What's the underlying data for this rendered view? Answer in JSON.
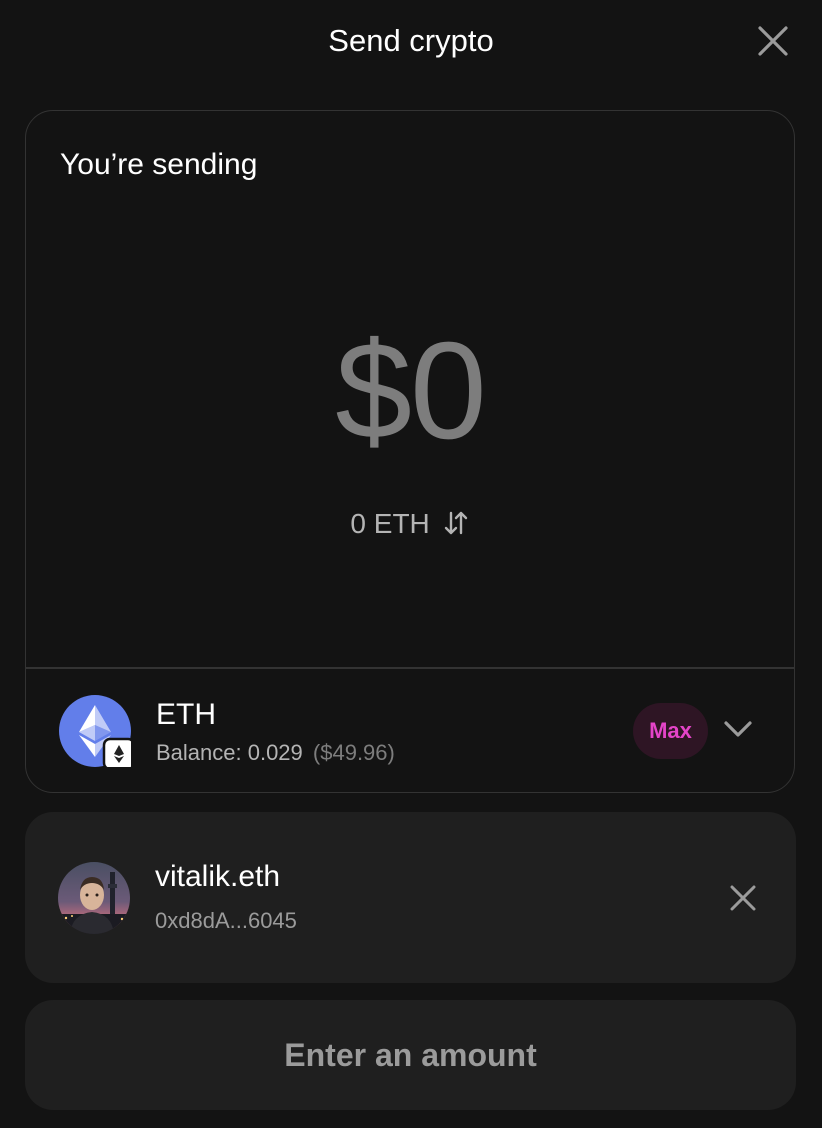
{
  "header": {
    "title": "Send crypto",
    "close_icon": "close-icon"
  },
  "send_card": {
    "label": "You’re sending",
    "amount_fiat": "$0",
    "amount_crypto": "0 ETH",
    "swap_icon": "swap-arrows-icon"
  },
  "token": {
    "symbol": "ETH",
    "balance": "Balance: 0.029",
    "balance_usd": "($49.96)",
    "max_label": "Max",
    "chevron_icon": "chevron-down-icon",
    "logo_color": "#627EEA",
    "max_color": "#E444C8"
  },
  "recipient": {
    "name": "vitalik.eth",
    "address": "0xd8dA...6045",
    "clear_icon": "close-icon"
  },
  "submit": {
    "label": "Enter an amount"
  },
  "colors": {
    "background": "#131313",
    "card": "#1F1F1F",
    "border": "#333333"
  }
}
